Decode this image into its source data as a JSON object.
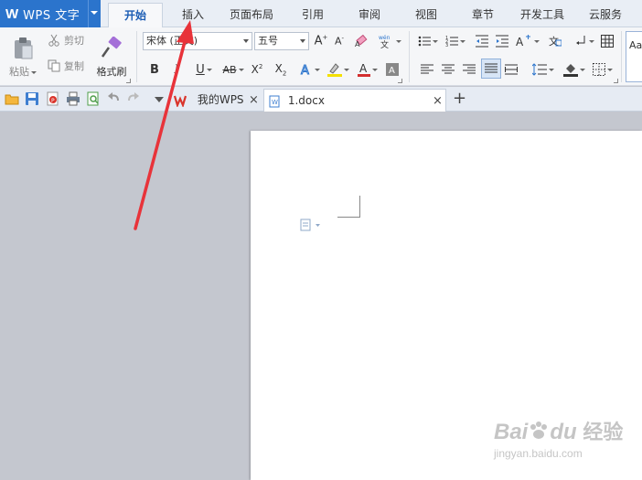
{
  "app": {
    "logo": "W",
    "name": "WPS 文字"
  },
  "menu_tabs": [
    "开始",
    "插入",
    "页面布局",
    "引用",
    "审阅",
    "视图",
    "章节",
    "开发工具",
    "云服务"
  ],
  "ribbon": {
    "paste_label": "粘贴",
    "cut_label": "剪切",
    "copy_label": "复制",
    "format_painter_label": "格式刷",
    "font_name": "宋体 (正文)",
    "font_size": "五号",
    "style_preview": "Aa"
  },
  "doc_tabs": {
    "my_wps_label": "我的WPS",
    "doc_label": "1.docx",
    "close_glyph": "×",
    "new_tab_glyph": "+"
  },
  "watermark": {
    "brand": "Bai",
    "brand_suffix": "du",
    "product": "经验",
    "url": "jingyan.baidu.com"
  },
  "colors": {
    "accent": "#2b74cc",
    "annotation_arrow": "#e8333a",
    "font_color_bar": "#d32f2f",
    "highlight_bar": "#f4e000"
  }
}
